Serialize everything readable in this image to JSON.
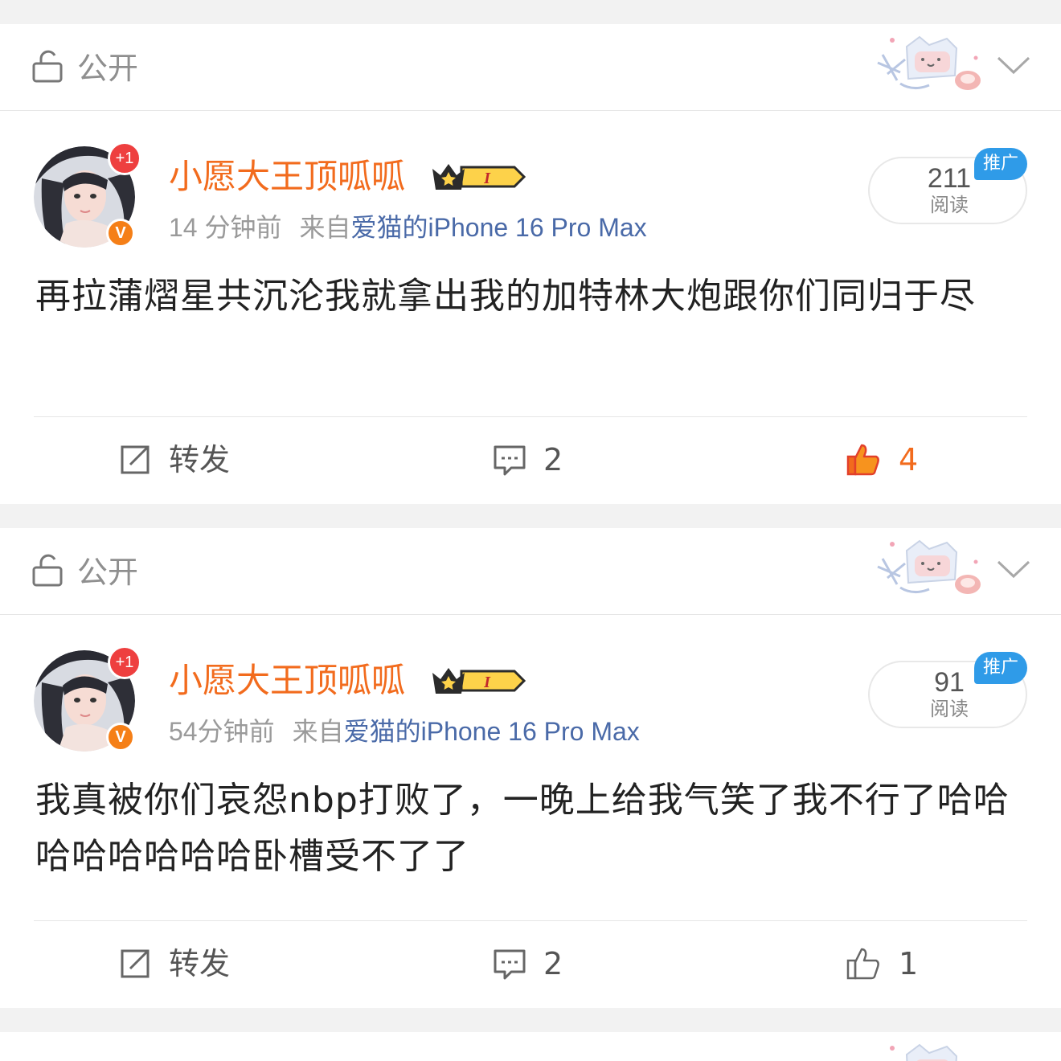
{
  "posts": [
    {
      "privacy": "公开",
      "author": "小愿大王顶呱呱",
      "avatar_badge": "+1",
      "verified_badge": "V",
      "vip_level": "I",
      "time": "14 分钟前",
      "source_prefix": "来自",
      "device": "爱猫的iPhone 16 Pro Max",
      "read_count": "211",
      "read_label": "阅读",
      "promo_tag": "推广",
      "text": "再拉蒲熠星共沉沦我就拿出我的加特林大炮跟你们同归于尽",
      "repost_label": "转发",
      "comment_count": "2",
      "like_count": "4",
      "liked": true
    },
    {
      "privacy": "公开",
      "author": "小愿大王顶呱呱",
      "avatar_badge": "+1",
      "verified_badge": "V",
      "vip_level": "I",
      "time": "54分钟前",
      "source_prefix": "来自",
      "device": "爱猫的iPhone 16 Pro Max",
      "read_count": "91",
      "read_label": "阅读",
      "promo_tag": "推广",
      "text": "我真被你们哀怨nbp打败了，一晚上给我气笑了我不行了哈哈哈哈哈哈哈哈卧槽受不了了",
      "repost_label": "转发",
      "comment_count": "2",
      "like_count": "1",
      "liked": false
    }
  ],
  "colors": {
    "author": "#f26b1d",
    "device_link": "#4a6aa8",
    "promo": "#2f9be8",
    "liked": "#f26b1d"
  }
}
